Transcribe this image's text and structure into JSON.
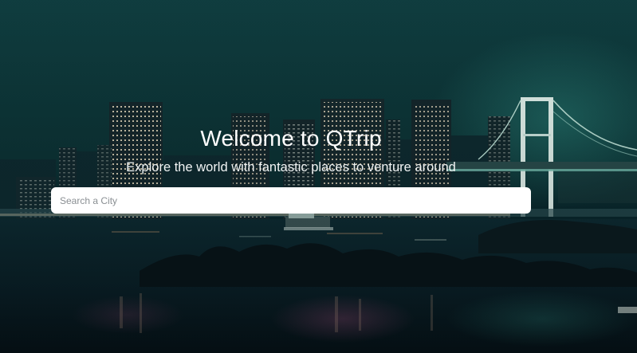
{
  "hero": {
    "title": "Welcome to QTrip",
    "subtitle": "Explore the world with fantastic places to venture around"
  },
  "search": {
    "placeholder": "Search a City",
    "value": ""
  },
  "colors": {
    "sky_top": "#0f3d40",
    "sky_bottom": "#071a1f",
    "text": "#ffffff",
    "search_bg": "#ffffff"
  }
}
